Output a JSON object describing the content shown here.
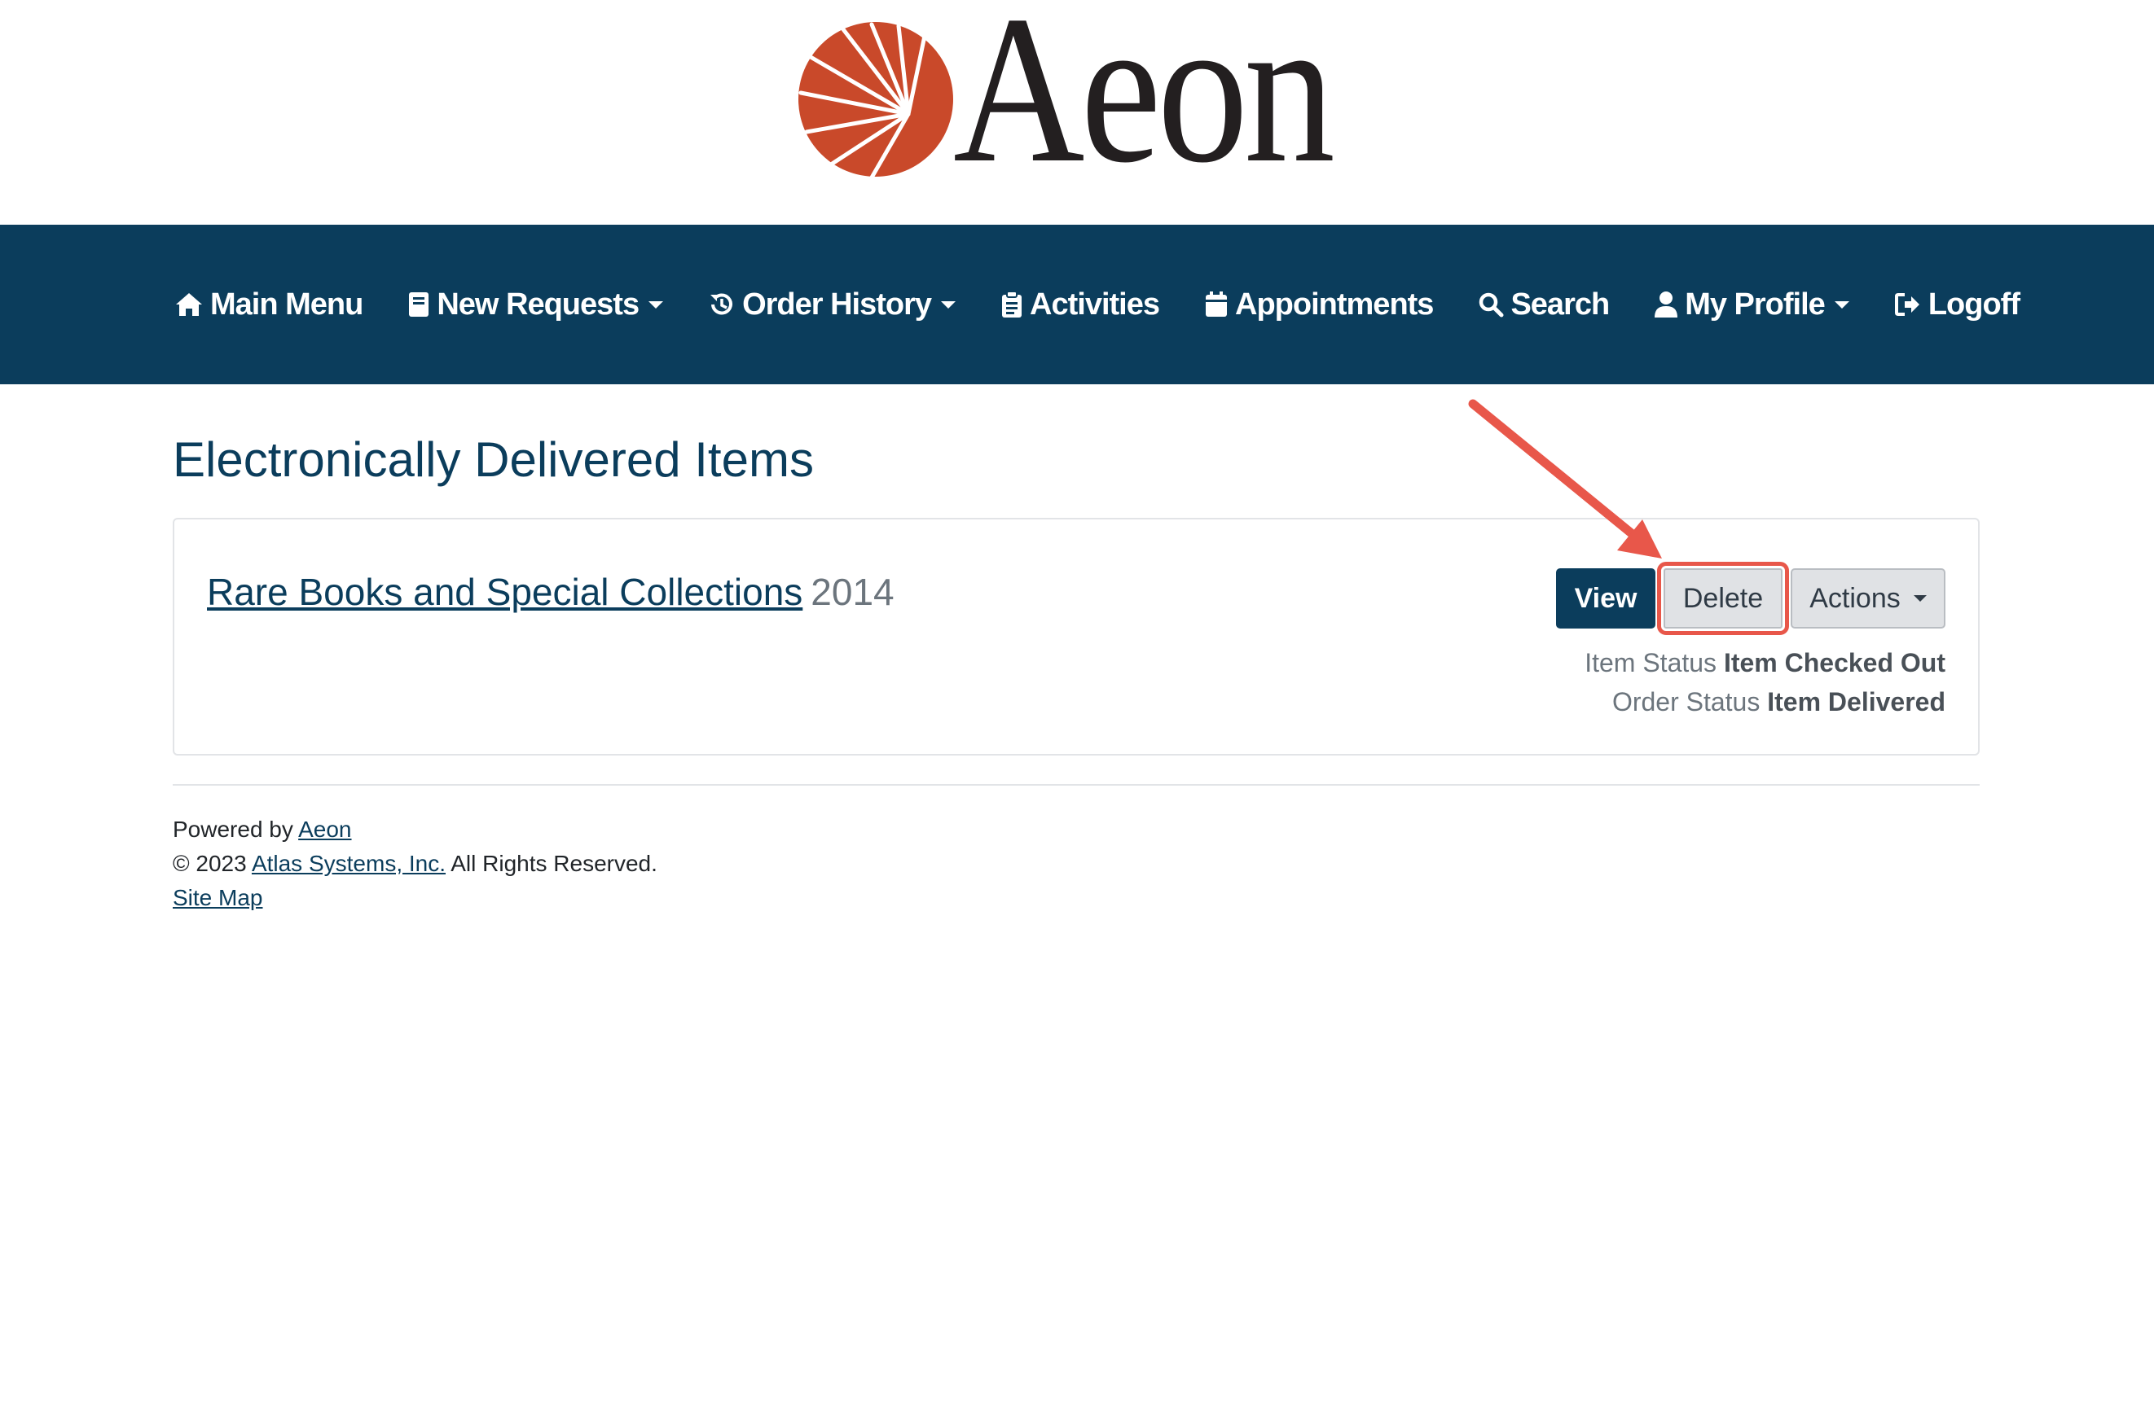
{
  "logo": {
    "text": "Aeon",
    "accent_color": "#c9492a"
  },
  "nav": {
    "background": "#0b3d5c",
    "items": [
      {
        "label": "Main Menu",
        "icon": "home-icon",
        "dropdown": false
      },
      {
        "label": "New Requests",
        "icon": "book-icon",
        "dropdown": true
      },
      {
        "label": "Order History",
        "icon": "history-icon",
        "dropdown": true
      },
      {
        "label": "Activities",
        "icon": "clipboard-icon",
        "dropdown": false
      },
      {
        "label": "Appointments",
        "icon": "calendar-icon",
        "dropdown": false
      },
      {
        "label": "Search",
        "icon": "search-icon",
        "dropdown": false
      },
      {
        "label": "My Profile",
        "icon": "user-icon",
        "dropdown": true
      },
      {
        "label": "Logoff",
        "icon": "logout-icon",
        "dropdown": false
      }
    ]
  },
  "page": {
    "title": "Electronically Delivered Items"
  },
  "item": {
    "title": "Rare Books and Special Collections",
    "year": "2014",
    "buttons": {
      "view": "View",
      "delete": "Delete",
      "actions": "Actions"
    },
    "item_status_label": "Item Status",
    "item_status_value": "Item Checked Out",
    "order_status_label": "Order Status",
    "order_status_value": "Item Delivered"
  },
  "footer": {
    "powered_by": "Powered by",
    "powered_link": "Aeon",
    "copyright": "© 2023",
    "company_link": "Atlas Systems, Inc.",
    "rights": "All Rights Reserved.",
    "sitemap_link": "Site Map"
  },
  "annotation": {
    "color": "#e8574a"
  }
}
